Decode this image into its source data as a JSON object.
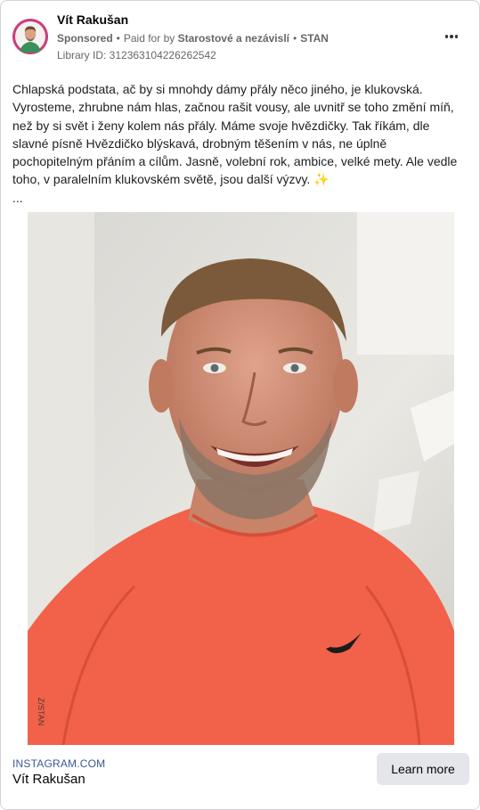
{
  "post": {
    "author": "Vít Rakušan",
    "sponsored_label": "Sponsored",
    "paid_for_prefix": "Paid for by",
    "payer": "Starostové a nezávislí",
    "payer_short": "STAN",
    "library_id": "Library ID: 312363104226262542"
  },
  "body": {
    "text": "Chlapská podstata, ač by si mnohdy dámy přály něco jiného, je klukovská. Vyrosteme, zhrubne nám hlas, začnou rašit vousy, ale uvnitř se toho změní míň, než by si svět i ženy kolem nás přály. Máme svoje hvězdičky. Tak říkám, dle slavné písně Hvězdičko blýskavá, drobným těšením v nás, ne úplně pochopitelným přáním a cílům. Jasně, volební rok, ambice, velké mety. Ale vedle toho, v paralelním klukovském světě, jsou další výzvy.",
    "emoji": "✨",
    "ellipsis": "..."
  },
  "image": {
    "watermark": "Z/STAN",
    "shirt_color": "#f2614a"
  },
  "footer": {
    "domain": "INSTAGRAM.COM",
    "title": "Vít Rakušan",
    "cta_label": "Learn more"
  },
  "colors": {
    "avatar_ring": "#cc3d7a",
    "link_blue": "#385898",
    "button_bg": "#e4e6eb"
  },
  "icons": {
    "more": "three-dots-icon",
    "sparkles": "sparkles-emoji"
  }
}
